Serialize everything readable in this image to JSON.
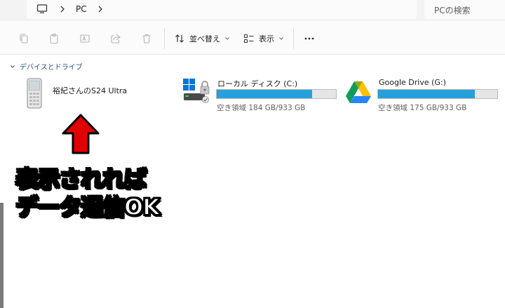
{
  "address": {
    "crumbs": [
      "PC"
    ],
    "search_placeholder": "PCの検索"
  },
  "toolbar": {
    "sort_label": "並べ替え",
    "view_label": "表示"
  },
  "group": {
    "label": "デバイスとドライブ"
  },
  "devices": [
    {
      "name": "裕紀さんのS24 Ultra",
      "icon": "phone-icon"
    },
    {
      "name": "ローカル ディスク (C:)",
      "icon": "windows-drive-icon",
      "free_text": "空き領域 184 GB/933 GB",
      "used_fraction": 0.8
    },
    {
      "name": "Google Drive (G:)",
      "icon": "google-drive-icon",
      "free_text": "空き領域 175 GB/933 GB",
      "used_fraction": 0.81
    }
  ],
  "annotation": {
    "line1": "表示されれば",
    "line2": "データ通信OK",
    "arrow_color": "#e00000"
  }
}
